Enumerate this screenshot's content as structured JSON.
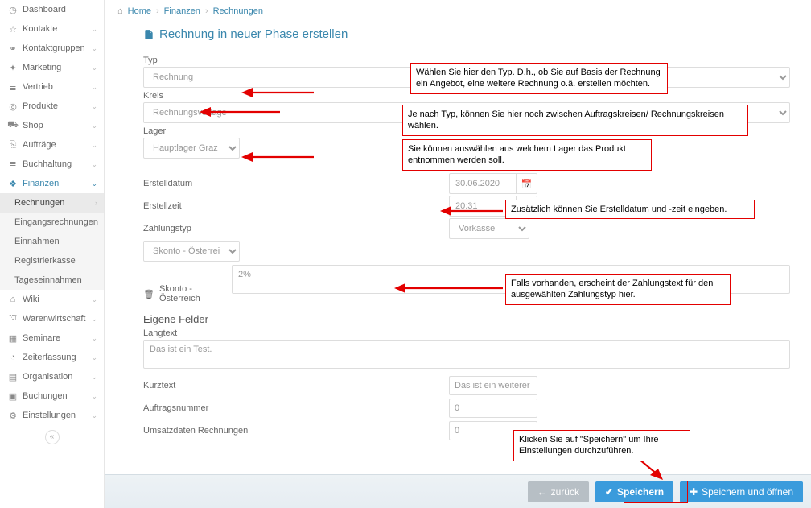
{
  "breadcrumb": {
    "home": "Home",
    "finanzen": "Finanzen",
    "rechnungen": "Rechnungen"
  },
  "title": "Rechnung in neuer Phase erstellen",
  "sidebar": {
    "items": [
      {
        "label": "Dashboard"
      },
      {
        "label": "Kontakte"
      },
      {
        "label": "Kontaktgruppen"
      },
      {
        "label": "Marketing"
      },
      {
        "label": "Vertrieb"
      },
      {
        "label": "Produkte"
      },
      {
        "label": "Shop"
      },
      {
        "label": "Aufträge"
      },
      {
        "label": "Buchhaltung"
      },
      {
        "label": "Finanzen"
      },
      {
        "label": "Wiki"
      },
      {
        "label": "Warenwirtschaft"
      },
      {
        "label": "Seminare"
      },
      {
        "label": "Zeiterfassung"
      },
      {
        "label": "Organisation"
      },
      {
        "label": "Buchungen"
      },
      {
        "label": "Einstellungen"
      }
    ],
    "finanzen_sub": [
      {
        "label": "Rechnungen"
      },
      {
        "label": "Eingangsrechnungen"
      },
      {
        "label": "Einnahmen"
      },
      {
        "label": "Registrierkasse"
      },
      {
        "label": "Tageseinnahmen"
      }
    ]
  },
  "form": {
    "typ_label": "Typ",
    "typ_value": "Rechnung",
    "kreis_label": "Kreis",
    "kreis_value": "Rechnungsvorlage",
    "lager_label": "Lager",
    "lager_value": "Hauptlager Graz",
    "erstelldatum_label": "Erstelldatum",
    "erstelldatum_value": "30.06.2020",
    "erstellzeit_label": "Erstellzeit",
    "erstellzeit_value": "20:31",
    "zahlungstyp_label": "Zahlungstyp",
    "zahlungstyp_value": "Vorkasse",
    "skonto_select": "Skonto - Österreich",
    "skonto_row_label": "Skonto - Österreich",
    "skonto_text": "2%",
    "eigene_felder_head": "Eigene Felder",
    "langtext_label": "Langtext",
    "langtext_value": "Das ist ein Test.",
    "kurztext_label": "Kurztext",
    "kurztext_value": "Das ist ein weiterer Test",
    "auftragsnr_label": "Auftragsnummer",
    "auftragsnr_value": "0",
    "umsatz_label": "Umsatzdaten Rechnungen",
    "umsatz_value": "0"
  },
  "buttons": {
    "back": "zurück",
    "save": "Speichern",
    "save_open": "Speichern und öffnen"
  },
  "callouts": {
    "typ": "Wählen Sie hier den Typ. D.h., ob Sie auf Basis der Rechnung ein Angebot, eine weitere Rechnung o.ä. erstellen möchten.",
    "kreis": "Je nach Typ, können Sie hier noch zwischen Auftragskreisen/ Rechnungskreisen wählen.",
    "lager": "Sie können auswählen aus welchem Lager das Produkt entnommen werden soll.",
    "datum": "Zusätzlich können Sie Erstelldatum und -zeit eingeben.",
    "zahlungstext": "Falls vorhanden, erscheint der Zahlungstext für den ausgewählten Zahlungstyp hier.",
    "speichern": "Klicken Sie auf \"Speichern\" um Ihre Einstellungen durchzuführen."
  }
}
